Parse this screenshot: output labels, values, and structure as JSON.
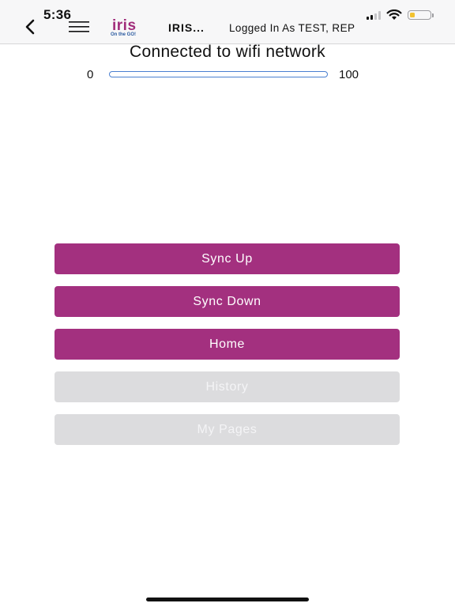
{
  "status_bar": {
    "time": "5:36",
    "signal_icon": "cellular-signal-icon",
    "wifi_icon": "wifi-icon",
    "battery_icon": "battery-icon",
    "battery_level": 0.25,
    "battery_color": "#f2c230"
  },
  "header": {
    "back_icon": "chevron-left-icon",
    "menu_icon": "hamburger-menu-icon",
    "logo": {
      "word": "iris",
      "tagline": "On the GO!"
    },
    "app_name": "IRIS...",
    "logged_in_text": "Logged In As TEST, REP"
  },
  "connection": {
    "status_text": "Connected to wifi network",
    "progress_min_label": "0",
    "progress_max_label": "100",
    "progress_value": 0,
    "progress_color": "#4a7fd0"
  },
  "actions": {
    "sync_up": "Sync Up",
    "sync_down": "Sync Down",
    "home": "Home",
    "history": "History",
    "my_pages": "My Pages"
  },
  "colors": {
    "brand": "#a3307f",
    "disabled": "#dcdcde"
  }
}
